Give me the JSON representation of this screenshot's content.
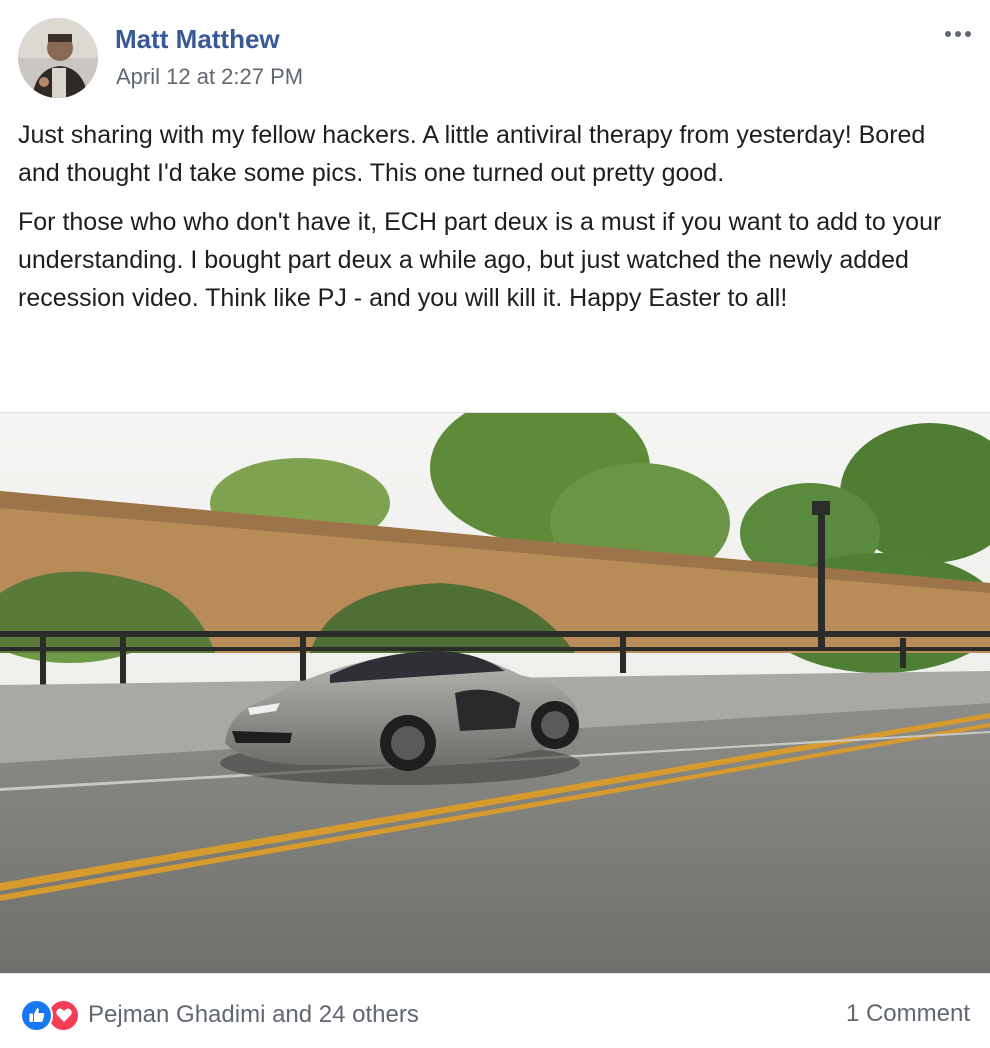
{
  "post": {
    "author": "Matt Matthew",
    "timestamp": "April 12 at 2:27 PM",
    "paragraphs": [
      "Just sharing with my fellow hackers. A little antiviral therapy from yesterday! Bored and thought I'd take some pics. This one turned out pretty good.",
      "For those who who don't have it, ECH part deux is a must if you want to add to your understanding. I bought part deux a while ago, but just watched the newly added recession video. Think like PJ - and you will kill it. Happy Easter to all!"
    ],
    "more_icon": "ellipsis-horizontal-icon"
  },
  "footer": {
    "reaction_icons": [
      "like-icon",
      "love-icon"
    ],
    "reactions_text": "Pejman Ghadimi and 24 others",
    "comments_text": "1 Comment"
  },
  "colors": {
    "author_link": "#385898",
    "secondary_text": "#606770",
    "like_blue": "#1877f2",
    "love_red": "#f33e58"
  }
}
